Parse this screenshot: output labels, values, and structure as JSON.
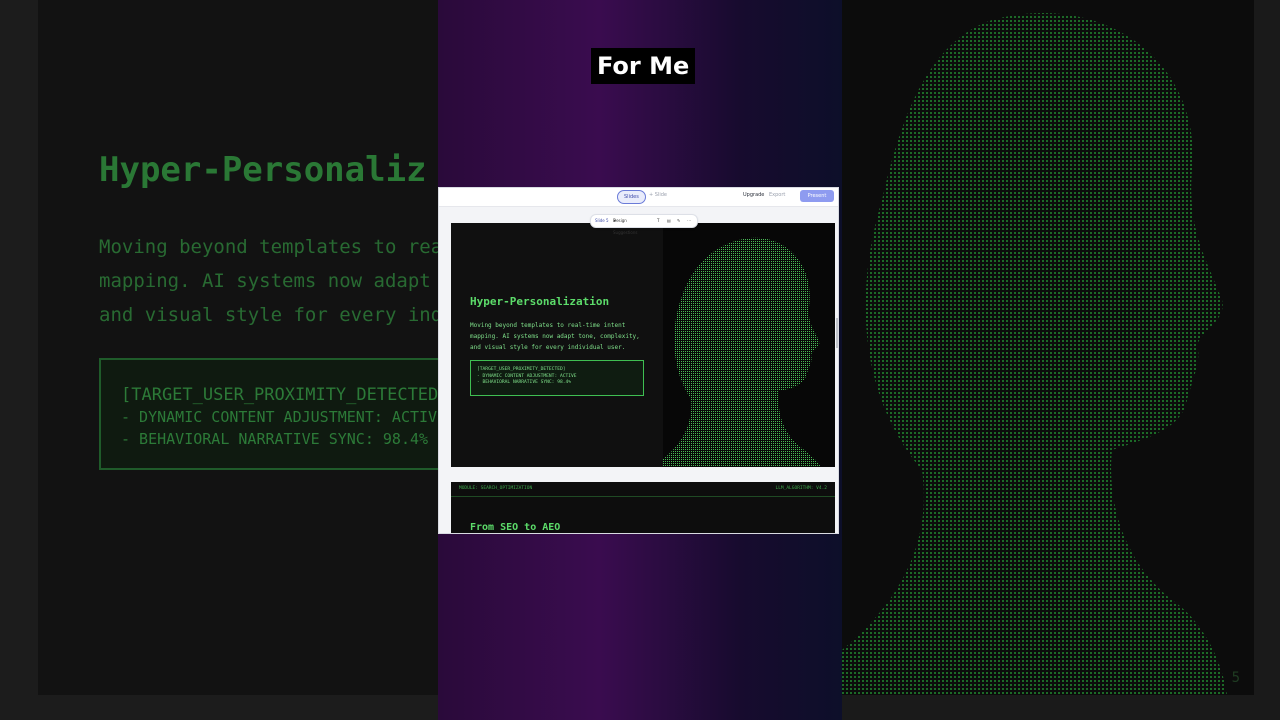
{
  "caption": "For Me",
  "background": {
    "title": "Hyper-Personaliz",
    "description_lines": [
      "Moving beyond templates to rea",
      "mapping. AI systems now adapt",
      "and visual style for every ind"
    ],
    "box_lines": [
      "[TARGET_USER_PROXIMITY_DETECTED]",
      "- DYNAMIC CONTENT ADJUSTMENT: ACTIV",
      "- BEHAVIORAL NARRATIVE SYNC: 98.4%"
    ],
    "slide_number": "5"
  },
  "app": {
    "topbar": {
      "slides_label": "Slides",
      "doc_tab": "+ Slide",
      "upgrade_label": "Upgrade",
      "export_label": "Export",
      "present_label": "Present"
    },
    "slide_toolbar": {
      "slide_label": "Slide 5",
      "design_label": "Design Suggestions"
    },
    "slide1": {
      "title": "Hyper-Personalization",
      "description": "Moving beyond templates to real-time intent mapping. AI systems now adapt tone, complexity, and visual style for every individual user.",
      "box_lines": [
        "[TARGET_USER_PROXIMITY_DETECTED]",
        "- DYNAMIC CONTENT ADJUSTMENT: ACTIVE",
        "- BEHAVIORAL NARRATIVE SYNC: 98.4%"
      ]
    },
    "slide2": {
      "header_left": "MODULE: SEARCH_OPTIMIZATION",
      "header_right": "LLM_ALGORITHM: V4.2",
      "title": "From SEO to AEO"
    }
  },
  "colors": {
    "terminal_green": "#5cdc6a",
    "accent_blue": "#8e9bf0",
    "backdrop_purple": "#3a0c4f"
  }
}
